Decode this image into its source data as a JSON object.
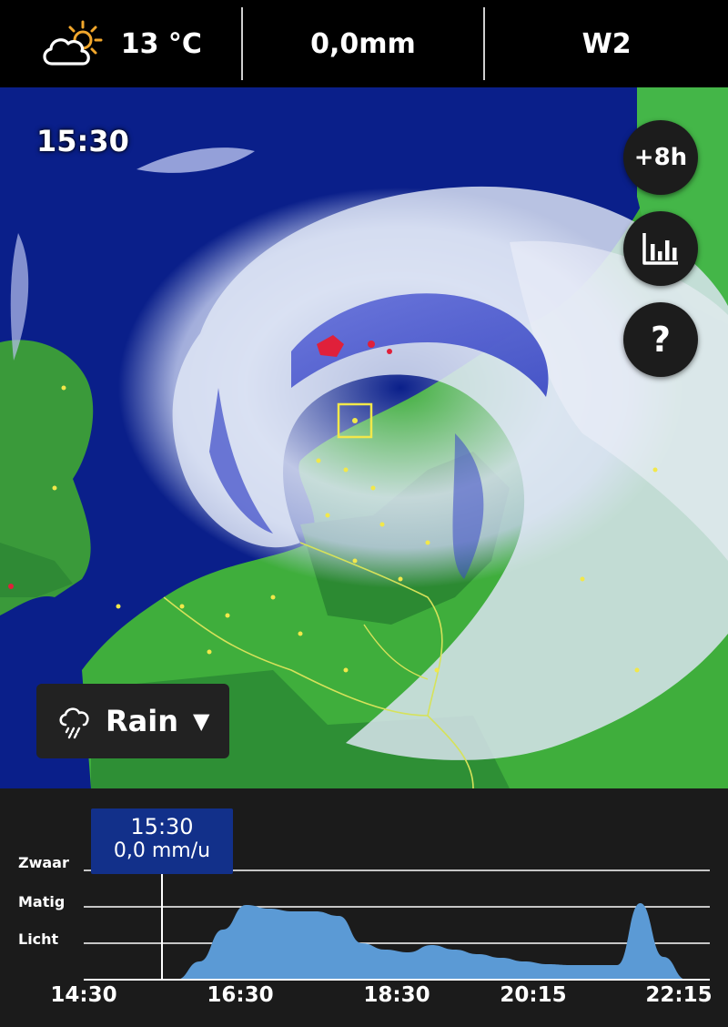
{
  "header": {
    "temperature": "13 °C",
    "precipitation": "0,0mm",
    "wind": "W2",
    "weather_icon": "partly-cloudy-icon"
  },
  "map": {
    "time": "15:30",
    "forecast_label": "+8h",
    "chart_icon": "bar-chart-icon",
    "help_label": "?",
    "layer": {
      "icon": "rain-cloud-icon",
      "label": "Rain",
      "caret": "▼"
    },
    "colors": {
      "sea": "#0a1f8a",
      "land": "#3fae3c",
      "rain_light": "#dfe6f5",
      "rain_moderate": "#3a48c8",
      "rain_heavy": "#e0203a"
    }
  },
  "panel": {
    "current_time": "15:30",
    "current_value": "0,0 mm/u",
    "y_levels": [
      "Zwaar",
      "Matig",
      "Licht"
    ],
    "x_ticks": [
      "14:30",
      "16:30",
      "18:30",
      "20:15",
      "22:15"
    ],
    "area_color": "#5b9ad5"
  },
  "chart_data": {
    "type": "area",
    "x": [
      "14:30",
      "15:00",
      "15:30",
      "16:00",
      "16:30",
      "16:45",
      "17:00",
      "17:15",
      "17:30",
      "17:45",
      "18:00",
      "18:15",
      "18:30",
      "18:45",
      "19:00",
      "19:15",
      "19:30",
      "19:45",
      "20:00",
      "20:15",
      "20:30",
      "20:45",
      "21:00",
      "21:15",
      "21:30",
      "21:45",
      "22:00",
      "22:15"
    ],
    "series": [
      {
        "values": [
          0,
          0,
          0,
          0,
          0,
          0.2,
          0.55,
          0.82,
          0.78,
          0.75,
          0.75,
          0.7,
          0.4,
          0.33,
          0.3,
          0.38,
          0.33,
          0.28,
          0.24,
          0.2,
          0.17,
          0.16,
          0.16,
          0.16,
          0.84,
          0.25,
          0,
          0
        ]
      }
    ],
    "y_categories": [
      "Licht",
      "Matig",
      "Zwaar"
    ],
    "ylim": [
      0,
      1.8
    ],
    "grid": true
  }
}
